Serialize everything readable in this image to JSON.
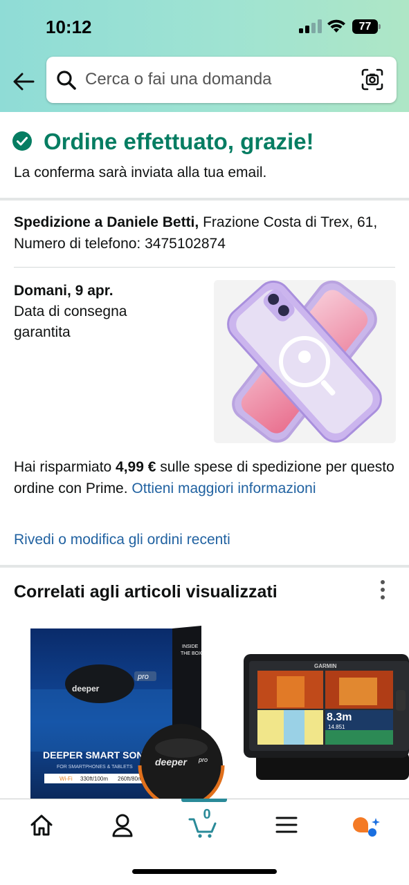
{
  "status_bar": {
    "time": "10:12",
    "battery": "77"
  },
  "search": {
    "placeholder": "Cerca o fai una domanda"
  },
  "confirmation": {
    "title": "Ordine effettuato, grazie!",
    "subtitle": "La conferma sarà inviata alla tua email."
  },
  "shipping": {
    "label": "Spedizione a Daniele Betti,",
    "address": " Frazione Costa di Trex, 61, Numero di telefono: 3475102874"
  },
  "delivery": {
    "date": "Domani, 9 apr.",
    "note": "Data di consegna garantita"
  },
  "savings": {
    "prefix": "Hai risparmiato ",
    "amount": "4,99 €",
    "suffix": " sulle spese di spedizione per questo ordine con Prime. ",
    "link": "Ottieni maggiori informazioni"
  },
  "review_link": "Rivedi o modifica gli ordini recenti",
  "related": {
    "title": "Correlati agli articoli visualizzati",
    "item1": {
      "brand": "deeper",
      "badge": "pro",
      "line1": "DEEPER SMART SON",
      "line2": "FOR SMARTPHONES & TABLETS",
      "spec1": "Wi-Fi",
      "spec2": "330ft/100m",
      "spec3": "260ft/80m",
      "side1": "INSIDE",
      "side2": "THE BOX"
    },
    "item2": {
      "brand": "GARMIN",
      "reading": "8.3m",
      "sub": "14.851"
    }
  },
  "bottom_nav": {
    "cart_count": "0"
  },
  "colors": {
    "success": "#067d62",
    "link": "#2162a1",
    "accent": "#2a8a98"
  }
}
